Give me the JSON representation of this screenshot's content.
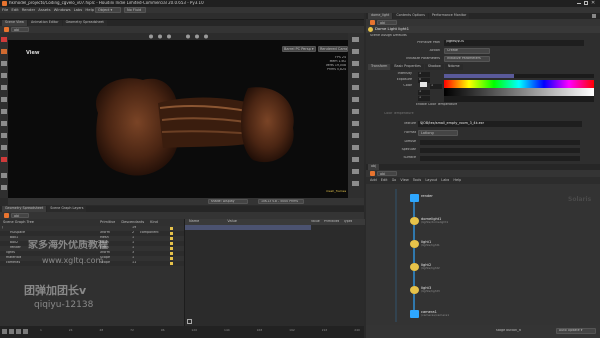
{
  "window": {
    "title": "hkmodel_projects/Coding_cgvelo_v07.hiplc - Houdini Indie Limited-Commercial 20.0.653 - Py3.10"
  },
  "menu": [
    "File",
    "Edit",
    "Render",
    "Assets",
    "Windows",
    "Labs",
    "Help"
  ],
  "shelf_tab": "Object ▾",
  "shelf_tab2": "No Fluid",
  "leftpane": {
    "tabs": [
      "Scene View",
      "Animation Editor",
      "Geometry Spreadsheet"
    ],
    "path": "obj",
    "view_label": "View",
    "persp": "Barrel PC Persp ▾",
    "cam": "Rendered Camera ▾",
    "stats": [
      "FPS 24",
      "Mem 1.6G",
      "Verts 19,008",
      "Prims 5,824"
    ],
    "status_text": "mesh_frames",
    "foot_btns": [
      "shade: Display",
      "10K13 v.b - 5000 Prims"
    ]
  },
  "spreadsheet": {
    "tabs": [
      "Geometry Spreadsheet",
      "Scene Graph Layers"
    ],
    "path": "obj",
    "tree_header": "Scene Graph Tree",
    "cols": [
      "Primitive",
      "Descendants",
      "Kind"
    ],
    "rows": [
      {
        "name": "/",
        "type": "",
        "desc": "19",
        "kind": ""
      },
      {
        "name": "HDSpace",
        "type": "Xform",
        "desc": "2",
        "kind": "component"
      },
      {
        "name": "box1",
        "type": "Mesh",
        "desc": "1",
        "kind": ""
      },
      {
        "name": "box2",
        "type": "Mesh",
        "desc": "1",
        "kind": ""
      },
      {
        "name": "render",
        "type": "Mesh",
        "desc": "1",
        "kind": ""
      },
      {
        "name": "lights",
        "type": "Xform",
        "desc": "3",
        "kind": ""
      },
      {
        "name": "materials",
        "type": "Scope",
        "desc": "1",
        "kind": ""
      },
      {
        "name": "cameras",
        "type": "Scope",
        "desc": "11",
        "kind": ""
      }
    ],
    "right_cols": [
      "Name",
      "Value"
    ],
    "right_tabs": [
      "Value",
      "Primitives",
      "Types"
    ]
  },
  "params": {
    "tabs": [
      "dome_light",
      "Contents Options",
      "Performance Monitor"
    ],
    "path": "obj",
    "node_title": "Dome Light  light1",
    "file_label": "Scene Assign Defaults",
    "rows": [
      {
        "label": "Primitive Path",
        "value": "/lights/$OS"
      },
      {
        "label": "Action",
        "value": "Create"
      },
      {
        "label": "Initialize Parameters",
        "value": "Initialize Parameters"
      }
    ],
    "subtabs": [
      "Transform",
      "Basic Properties",
      "Shadow",
      "Ndome"
    ],
    "props": [
      {
        "label": "Intensity",
        "value": "1"
      },
      {
        "label": "Exposure",
        "value": "0"
      },
      {
        "label": "Color",
        "value": "1"
      },
      {
        "label": "",
        "value": "1"
      },
      {
        "label": "",
        "value": "1"
      }
    ],
    "enable_color_temp": "Enable Color Temperature",
    "color_temp": "Color Temperature",
    "file_row": {
      "label": "Texture",
      "value": "$JOB/tex/small_empty_room_3_4k.exr"
    },
    "format_row": {
      "label": "Format",
      "value": "Latlong"
    },
    "bottom_rows": [
      "Diffuse",
      "Specular",
      "Surface"
    ]
  },
  "network": {
    "tabs": [
      "obj"
    ],
    "path": "obj",
    "menu": [
      "Add",
      "Edit",
      "Go",
      "View",
      "Tools",
      "Layout",
      "Labs",
      "Help"
    ],
    "watermark": "Solaris",
    "nodes": [
      {
        "name": "render",
        "sub": ""
      },
      {
        "name": "domelight1",
        "sub": "/lights/domelight1"
      },
      {
        "name": "light1",
        "sub": "/lights/light1"
      },
      {
        "name": "light2",
        "sub": "/lights/light2"
      },
      {
        "name": "light3",
        "sub": "/lights/light3"
      },
      {
        "name": "camera1",
        "sub": "/cameras/camera1"
      }
    ],
    "status_left": "stage button_lt",
    "status_right": "Auto Update ▾"
  },
  "timeline": {
    "frames": [
      "1",
      "24",
      "48",
      "72",
      "96",
      "120",
      "144",
      "168",
      "192",
      "216",
      "240"
    ]
  },
  "watermarks": {
    "a": "家多海外优质教程",
    "b": "www.xgltq.com",
    "c": "团弹加团长v",
    "d": "qiqiyu-12138"
  },
  "colors": {
    "accent": "#f5c518",
    "node_bulb": "#e6c24a",
    "wire": "#2ea7ff",
    "mac": "#e8c247"
  }
}
